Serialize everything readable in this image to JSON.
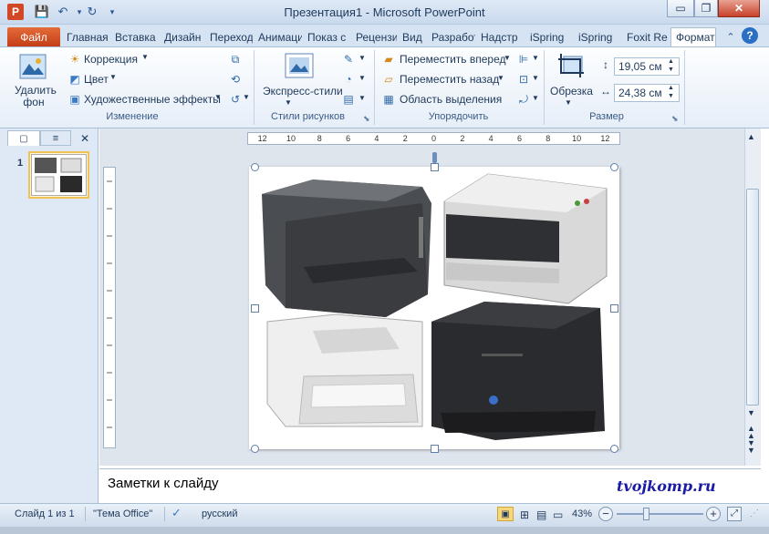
{
  "window": {
    "title": "Презентация1 - Microsoft PowerPoint",
    "app_icon": "P",
    "controls": {
      "minimize": "▭",
      "restore": "❐",
      "close": "✕"
    }
  },
  "qat": {
    "save_icon": "save-icon",
    "undo_icon": "undo-icon",
    "redo_icon": "redo-icon"
  },
  "tabs": [
    {
      "label": "Файл"
    },
    {
      "label": "Главная"
    },
    {
      "label": "Вставка"
    },
    {
      "label": "Дизайн"
    },
    {
      "label": "Переход"
    },
    {
      "label": "Анимации"
    },
    {
      "label": "Показ с"
    },
    {
      "label": "Рецензи"
    },
    {
      "label": "Вид"
    },
    {
      "label": "Разработ"
    },
    {
      "label": "Надстр"
    },
    {
      "label": "iSpring"
    },
    {
      "label": "iSpring"
    },
    {
      "label": "Foxit Re"
    },
    {
      "label": "Формат"
    }
  ],
  "ribbon": {
    "groups": {
      "change": {
        "label": "Изменение",
        "remove_bg": "Удалить фон",
        "correction": "Коррекция",
        "color": "Цвет",
        "artistic": "Художественные эффекты"
      },
      "styles": {
        "label": "Стили рисунков",
        "express": "Экспресс-стили"
      },
      "arrange": {
        "label": "Упорядочить",
        "forward": "Переместить вперед",
        "backward": "Переместить назад",
        "selection": "Область выделения"
      },
      "size": {
        "label": "Размер",
        "crop": "Обрезка",
        "height": "19,05 см",
        "width": "24,38 см"
      }
    }
  },
  "ruler": {
    "labels": [
      "12",
      "10",
      "8",
      "6",
      "4",
      "2",
      "0",
      "2",
      "4",
      "6",
      "8",
      "10",
      "12"
    ]
  },
  "slides": [
    {
      "number": "1"
    }
  ],
  "notes": {
    "placeholder": "Заметки к слайду"
  },
  "watermark": "tvojkomp.ru",
  "status": {
    "slide": "Слайд 1 из 1",
    "theme": "\"Тема Office\"",
    "language": "русский",
    "zoom": "43%"
  },
  "colors": {
    "file_tab": "#c43e16",
    "accent": "#1e395b",
    "close": "#c7412a",
    "watermark": "#1a1aa6"
  }
}
